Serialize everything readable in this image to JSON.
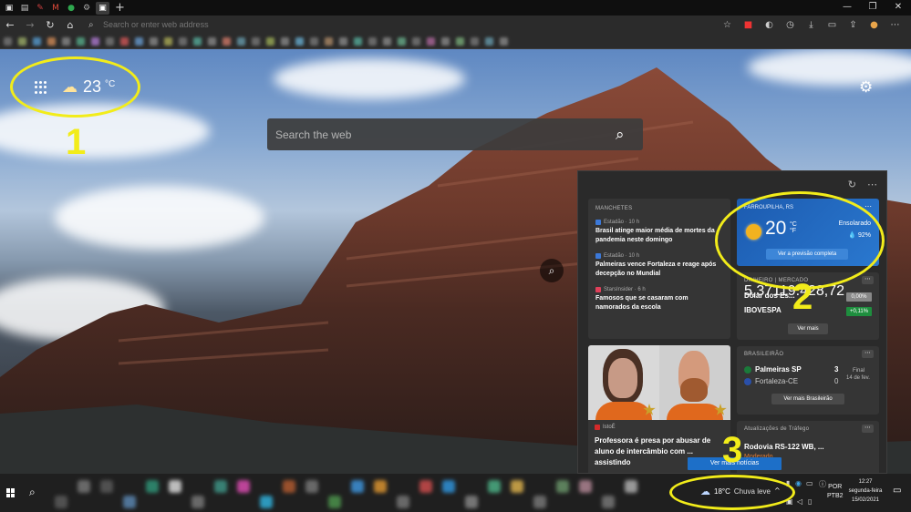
{
  "browser": {
    "tabs": [
      {
        "icon": "edge-tab-icon",
        "glyph": "▣",
        "color": "#dddddd"
      },
      {
        "icon": "document-tab-icon",
        "glyph": "▤",
        "color": "#cccccc"
      },
      {
        "icon": "leaf-tab-icon",
        "glyph": "✎",
        "color": "#d04040"
      },
      {
        "icon": "gmail-tab-icon",
        "glyph": "M",
        "color": "#e04b3b"
      },
      {
        "icon": "green-tab-icon",
        "glyph": "●",
        "color": "#2fa84f"
      },
      {
        "icon": "gear-tab-icon",
        "glyph": "⚙",
        "color": "#aaaaaa"
      },
      {
        "icon": "newtab-tab-icon",
        "glyph": "▣",
        "color": "#ffffff"
      }
    ],
    "new_tab_glyph": "+",
    "window_buttons": [
      "—",
      "❐",
      "✕"
    ],
    "address_placeholder": "Search or enter web address"
  },
  "newtab": {
    "weather_temp": "23",
    "weather_unit": "°C",
    "search_placeholder": "Search the web",
    "annotations": [
      "1",
      "2",
      "3"
    ]
  },
  "panel": {
    "news_header": "MANCHETES",
    "news": [
      {
        "source": "Estadão · 10 h",
        "headline": "Brasil atinge maior média de mortes da pandemia neste domingo",
        "icon_color": "#3b78d8"
      },
      {
        "source": "Estadão · 10 h",
        "headline": "Palmeiras vence Fortaleza e reage após decepção no Mundial",
        "icon_color": "#3b78d8"
      },
      {
        "source": "StarsInsider · 6 h",
        "headline": "Famosos que se casaram com namorados da escola",
        "icon_color": "#e0405a"
      }
    ],
    "weather": {
      "location": "FARROUPILHA, RS",
      "temp": "20",
      "unit_c": "°C",
      "unit_f": "°F",
      "condition": "Ensolarado",
      "humidity": "💧 92%",
      "button": "Ver a previsão completa"
    },
    "money": {
      "header": "DINHEIRO | MERCADO",
      "rows": [
        {
          "name": "Dólar dos Es...",
          "value": "5,37",
          "change": "0,00%",
          "color": "#888888"
        },
        {
          "name": "IBOVESPA",
          "value": "119.428,72",
          "change": "+0,11%",
          "color": "#1e8e3e"
        }
      ],
      "button": "Ver mais"
    },
    "sport": {
      "header": "BRASILEIRÃO",
      "team1": "Palmeiras SP",
      "score1": "3",
      "team2": "Fortaleza-CE",
      "score2": "0",
      "status": "Final",
      "date": "14 de fev.",
      "button": "Ver mais Brasileirão"
    },
    "traffic": {
      "header": "Atualizações de Tráfego",
      "road": "Rodovia RS-122 WB, ...",
      "status": "Moderado"
    },
    "photo_story": {
      "source": "IstoÉ",
      "headline": "Professora é presa por abusar de aluno de intercâmbio com ... assistindo"
    },
    "more_news_button": "Ver mais notícias"
  },
  "taskbar": {
    "weather_temp": "18°C",
    "weather_desc": "Chuva leve",
    "lang": "POR",
    "lang2": "PTB2",
    "time": "12:27",
    "day": "segunda-feira",
    "date": "15/02/2021"
  }
}
